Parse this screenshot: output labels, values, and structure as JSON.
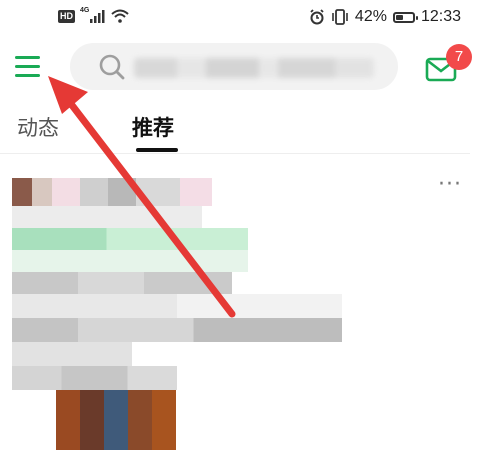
{
  "status_bar": {
    "hd_label": "HD",
    "network_type": "4G",
    "battery_percent": "42%",
    "battery_level": 0.42,
    "time": "12:33"
  },
  "header": {
    "menu_icon": "hamburger-menu-icon",
    "search_icon": "search-icon",
    "search_placeholder": "",
    "mail_icon": "mail-icon",
    "mail_badge_count": "7"
  },
  "tabs": [
    {
      "label": "动态",
      "active": false
    },
    {
      "label": "推荐",
      "active": true
    }
  ],
  "feed": {
    "more_icon": "more-dots-icon",
    "more_label": "···"
  },
  "colors": {
    "accent_green": "#1aaa55",
    "badge_red": "#f24a4a",
    "arrow_red": "#e53935"
  }
}
